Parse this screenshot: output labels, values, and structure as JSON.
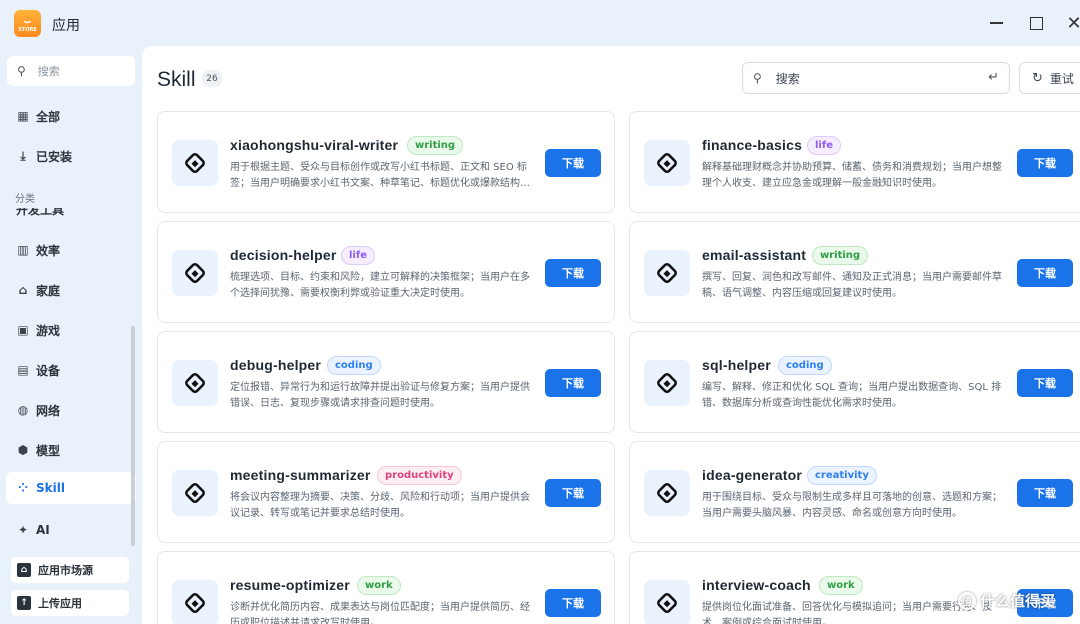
{
  "window": {
    "app_logo_text": "STORE",
    "title": "应用",
    "controls": {
      "minimize": "—",
      "maximize": "□",
      "close": "✕"
    }
  },
  "sidebar": {
    "search_placeholder": "搜索",
    "top_items": [
      {
        "label": "全部",
        "icon": "grid-icon"
      },
      {
        "label": "已安装",
        "icon": "download-icon"
      }
    ],
    "category_label": "分类",
    "partial_item": "开发工具",
    "categories": [
      {
        "label": "效率",
        "icon": "chart-icon"
      },
      {
        "label": "家庭",
        "icon": "home-icon"
      },
      {
        "label": "游戏",
        "icon": "gamepad-icon"
      },
      {
        "label": "设备",
        "icon": "device-icon"
      },
      {
        "label": "网络",
        "icon": "globe-icon"
      },
      {
        "label": "模型",
        "icon": "cube-icon"
      },
      {
        "label": "Skill",
        "icon": "apps-icon",
        "active": true
      },
      {
        "label": "AI",
        "icon": "sparkle-icon"
      }
    ],
    "bottom": [
      {
        "label": "应用市场源",
        "icon": "store-icon"
      },
      {
        "label": "上传应用",
        "icon": "upload-icon"
      }
    ]
  },
  "main": {
    "title": "Skill",
    "count": "26",
    "search_placeholder": "搜索",
    "reset_label": "重试",
    "download_label": "下载",
    "cards": [
      {
        "name": "xiaohongshu-viral-writer",
        "tag": "writing",
        "description": "用于根据主题、受众与目标创作或改写小红书标题、正文和 SEO 标签；当用户明确要求小红书文案、种草笔记、标题优化或爆款结构时使用。"
      },
      {
        "name": "finance-basics",
        "tag": "life",
        "description": "解释基础理财概念并协助预算、储蓄、债务和消费规划；当用户想整理个人收支、建立应急金或理解一般金融知识时使用。"
      },
      {
        "name": "decision-helper",
        "tag": "life",
        "description": "梳理选项、目标、约束和风险，建立可解释的决策框架；当用户在多个选择间犹豫、需要权衡利弊或验证重大决定时使用。"
      },
      {
        "name": "email-assistant",
        "tag": "writing",
        "description": "撰写、回复、润色和改写邮件、通知及正式消息；当用户需要邮件草稿、语气调整、内容压缩或回复建议时使用。"
      },
      {
        "name": "debug-helper",
        "tag": "coding",
        "description": "定位报错、异常行为和运行故障并提出验证与修复方案；当用户提供错误、日志、复现步骤或请求排查问题时使用。"
      },
      {
        "name": "sql-helper",
        "tag": "coding",
        "description": "编写、解释、修正和优化 SQL 查询；当用户提出数据查询、SQL 排错、数据库分析或查询性能优化需求时使用。"
      },
      {
        "name": "meeting-summarizer",
        "tag": "productivity",
        "description": "将会议内容整理为摘要、决策、分歧、风险和行动项；当用户提供会议记录、转写或笔记并要求总结时使用。"
      },
      {
        "name": "idea-generator",
        "tag": "creativity",
        "description": "用于围绕目标、受众与限制生成多样且可落地的创意、选题和方案；当用户需要头脑风暴、内容灵感、命名或创意方向时使用。"
      },
      {
        "name": "resume-optimizer",
        "tag": "work",
        "description": "诊断并优化简历内容、成果表达与岗位匹配度；当用户提供简历、经历或职位描述并请求改写时使用。"
      },
      {
        "name": "interview-coach",
        "tag": "work",
        "description": "提供岗位化面试准备、回答优化与模拟追问；当用户需要行为、技术、案例或综合面试时使用。"
      }
    ]
  },
  "watermark": {
    "text": "什么值得买",
    "icon_text": "值"
  }
}
